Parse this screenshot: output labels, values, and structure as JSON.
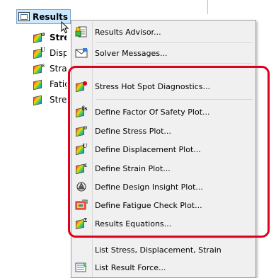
{
  "colors": {
    "highlight": "#e0001b",
    "selection": "#cce8ff",
    "menu_bg": "#f0f0f0"
  },
  "tree": {
    "root": {
      "label": "Results",
      "icon": "results-folder-icon"
    },
    "items": [
      {
        "label": "Stre",
        "subscript": "σ",
        "bold": true
      },
      {
        "label": "Displ",
        "subscript": "U"
      },
      {
        "label": "Strai",
        "subscript": "ε"
      },
      {
        "label": "Fatig",
        "subscript": ""
      },
      {
        "label": "Stres",
        "subscript": ""
      }
    ]
  },
  "menu": {
    "items": [
      {
        "label": "Results Advisor...",
        "icon": "results-advisor-icon"
      },
      {
        "label": "Solver Messages...",
        "icon": "solver-messages-icon"
      },
      {
        "label": "Stress Hot Spot Diagnostics...",
        "icon": "hot-spot-icon"
      },
      {
        "label": "Define Factor Of Safety Plot...",
        "icon": "factor-of-safety-icon",
        "subscript": "fs"
      },
      {
        "label": "Define Stress Plot...",
        "icon": "stress-plot-icon",
        "subscript": "σ"
      },
      {
        "label": "Define Displacement Plot...",
        "icon": "displacement-plot-icon",
        "subscript": "U"
      },
      {
        "label": "Define Strain Plot...",
        "icon": "strain-plot-icon",
        "subscript": "ε"
      },
      {
        "label": "Define Design Insight Plot...",
        "icon": "design-insight-icon"
      },
      {
        "label": "Define Fatigue Check Plot...",
        "icon": "fatigue-check-icon"
      },
      {
        "label": "Results Equations...",
        "icon": "results-equations-icon",
        "subscript": "Σ"
      },
      {
        "label": "List Stress, Displacement, Strain",
        "icon": ""
      },
      {
        "label": "List Result Force...",
        "icon": "list-result-force-icon"
      }
    ]
  }
}
